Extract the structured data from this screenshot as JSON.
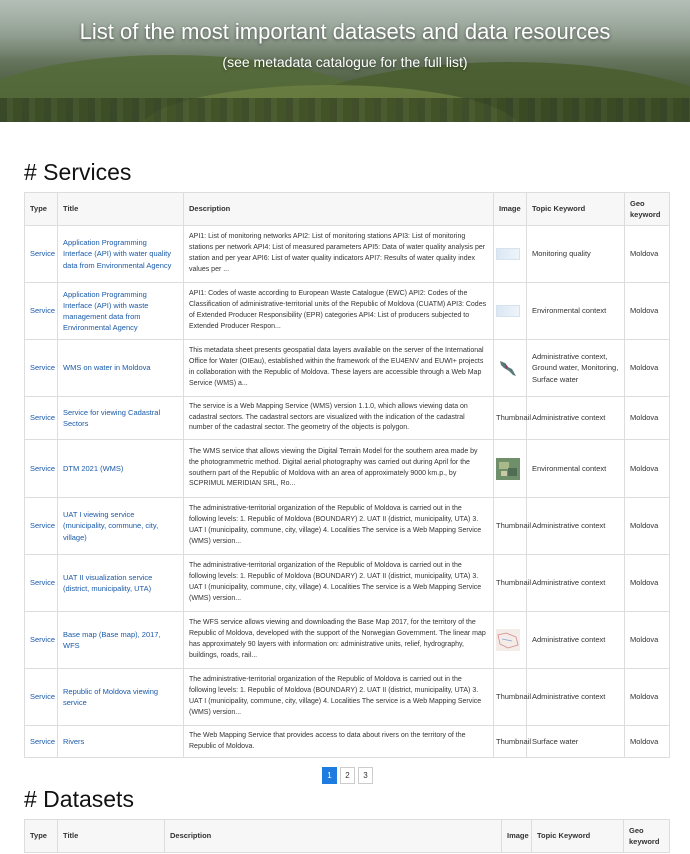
{
  "hero": {
    "title": "List of the most important datasets and data resources",
    "subtitle": "(see metadata catalogue for the full list)"
  },
  "services": {
    "heading": "# Services",
    "columns": [
      "Type",
      "Title",
      "Description",
      "Image",
      "Topic Keyword",
      "Geo keyword"
    ],
    "rows": [
      {
        "type": "Service",
        "title": "Application Programming Interface (API) with water quality data from Environmental Agency",
        "description": "API1: List of monitoring networks API2: List of monitoring stations API3: List of monitoring stations per network API4: List of measured parameters API5: Data of water quality analysis per station and per year API6: List of water quality indicators API7: Results of water quality index values per ...",
        "image": "",
        "keyword": "Monitoring quality",
        "geo": "Moldova"
      },
      {
        "type": "Service",
        "title": "Application Programming Interface (API) with waste management data from Environmental Agency",
        "description": "API1: Codes of waste according to European Waste Catalogue (EWC) API2: Codes of the Classification of administrative-territorial units of the Republic of Moldova (CUATM) API3: Codes of Extended Producer Responsibility (EPR) categories API4: List of producers subjected to Extended Producer Respon...",
        "image": "",
        "keyword": "Environmental context",
        "geo": "Moldova"
      },
      {
        "type": "Service",
        "title": "WMS on water in Moldova",
        "description": "This metadata sheet presents geospatial data layers available on the server of the International Office for Water (OIEau), established within the framework of the EU4ENV and EUWI+ projects in collaboration with the Republic of Moldova. These layers are accessible through a Web Map Service (WMS) a...",
        "image": "",
        "keyword": "Administrative context, Ground water, Monitoring, Surface water",
        "geo": "Moldova"
      },
      {
        "type": "Service",
        "title": "Service for viewing Cadastral Sectors",
        "description": "The service is a Web Mapping Service (WMS) version 1.1.0, which allows viewing data on cadastral sectors. The cadastral sectors are visualized with the indication of the cadastral number of the cadastral sector. The geometry of the objects is polygon.",
        "image": "Thumbnail",
        "keyword": "Administrative context",
        "geo": "Moldova"
      },
      {
        "type": "Service",
        "title": "DTM 2021 (WMS)",
        "description": "The WMS service that allows viewing the Digital Terrain Model for the southern area made by the photogrammetric method. Digital aerial photography was carried out during April for the southern part of the Republic of Moldova with an area of approximately 9000 km.p., by SCPRIMUL MERIDIAN SRL, Ro...",
        "image": "",
        "keyword": "Environmental context",
        "geo": "Moldova"
      },
      {
        "type": "Service",
        "title": "UAT I viewing service (municipality, commune, city, village)",
        "description": "The administrative-territorial organization of the Republic of Moldova is carried out in the following levels: 1. Republic of Moldova (BOUNDARY) 2. UAT II (district, municipality, UTA) 3. UAT I (municipality, commune, city, village) 4. Localities The service is a Web Mapping Service (WMS) version...",
        "image": "Thumbnail",
        "keyword": "Administrative context",
        "geo": "Moldova"
      },
      {
        "type": "Service",
        "title": "UAT II visualization service (district, municipality, UTA)",
        "description": "The administrative-territorial organization of the Republic of Moldova is carried out in the following levels: 1. Republic of Moldova (BOUNDARY) 2. UAT II (district, municipality, UTA) 3. UAT I (municipality, commune, city, village) 4. Localities The service is a Web Mapping Service (WMS) version...",
        "image": "Thumbnail",
        "keyword": "Administrative context",
        "geo": "Moldova"
      },
      {
        "type": "Service",
        "title": "Base map (Base map), 2017, WFS",
        "description": "The WFS service allows viewing and downloading the Base Map 2017, for the territory of the Republic of Moldova, developed with the support of the Norwegian Government. The linear map has approximately 90 layers with information on: administrative units, relief, hydrography, buildings, roads, rail...",
        "image": "",
        "keyword": "Administrative context",
        "geo": "Moldova"
      },
      {
        "type": "Service",
        "title": "Republic of Moldova viewing service",
        "description": "The administrative-territorial organization of the Republic of Moldova is carried out in the following levels: 1. Republic of Moldova (BOUNDARY) 2. UAT II (district, municipality, UTA) 3. UAT I (municipality, commune, city, village) 4. Localities The service is a Web Mapping Service (WMS) version...",
        "image": "Thumbnail",
        "keyword": "Administrative context",
        "geo": "Moldova"
      },
      {
        "type": "Service",
        "title": "Rivers",
        "description": "The Web Mapping Service that provides access to data about rivers on the territory of the Republic of Moldova.",
        "image": "Thumbnail",
        "keyword": "Surface water",
        "geo": "Moldova"
      }
    ]
  },
  "pagination": {
    "pages": [
      "1",
      "2",
      "3"
    ],
    "active": "1"
  },
  "datasets": {
    "heading": "# Datasets",
    "columns": [
      "Type",
      "Title",
      "Description",
      "Image",
      "Topic Keyword",
      "Geo keyword"
    ]
  },
  "colors": {
    "link": "#1a5aa8",
    "pager_active": "#1e7be0"
  }
}
